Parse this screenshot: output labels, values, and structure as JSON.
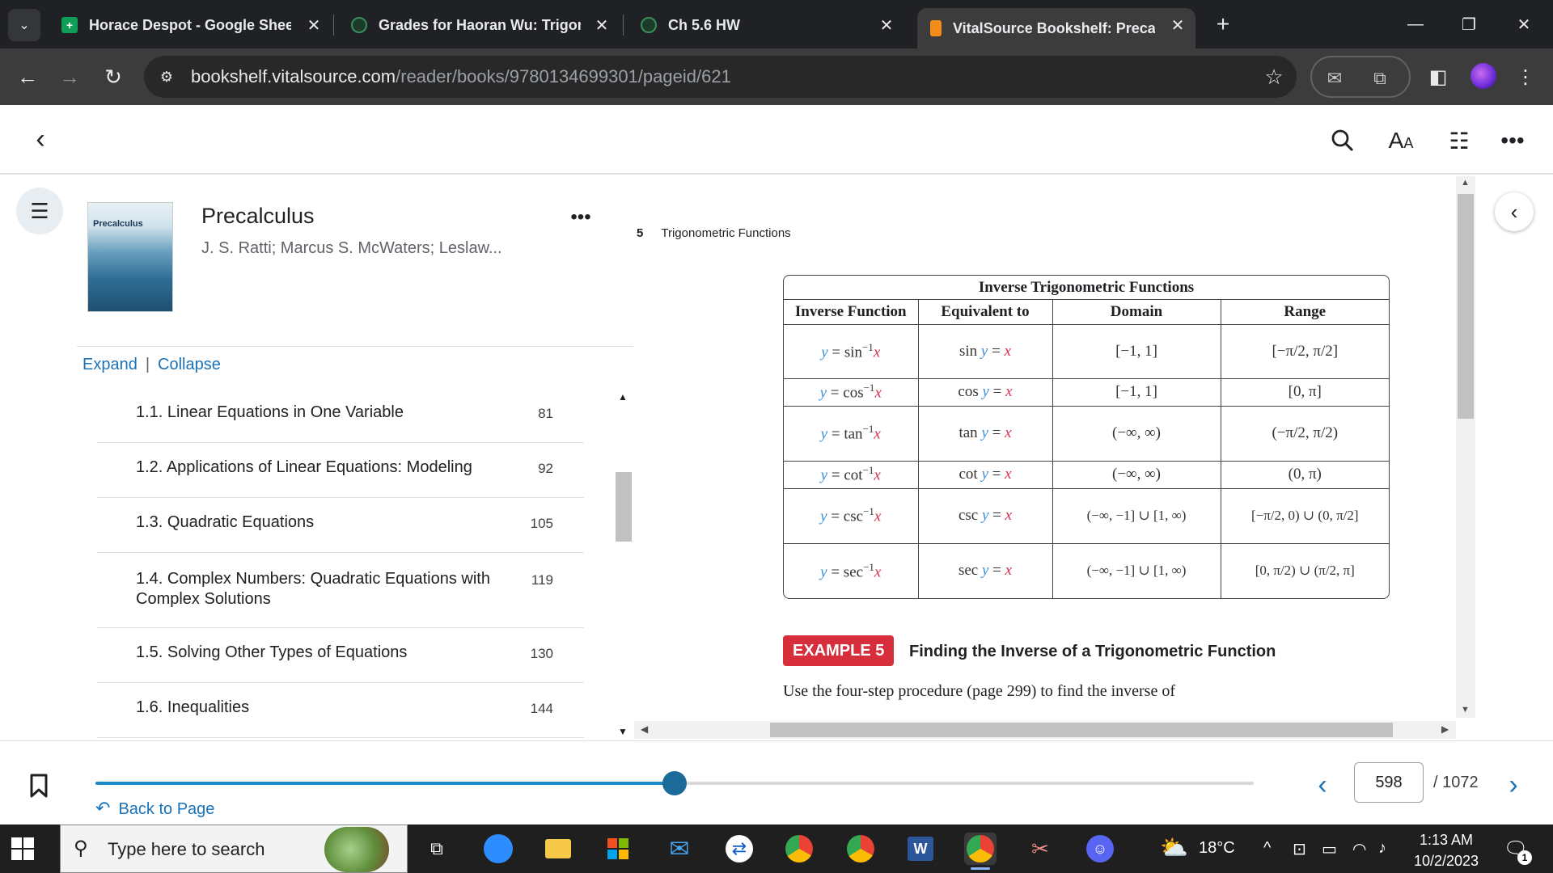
{
  "browser": {
    "tabs": [
      {
        "title": "Horace Despot - Google Sheets",
        "icon": "google-sheets-icon"
      },
      {
        "title": "Grades for Haoran Wu: Trigonometry",
        "icon": "canvas-icon"
      },
      {
        "title": "Ch 5.6 HW",
        "icon": "canvas-icon"
      },
      {
        "title": "VitalSource Bookshelf: Precalculus",
        "icon": "vitalsource-icon"
      }
    ],
    "url_host": "bookshelf.vitalsource.com",
    "url_path": "/reader/books/9780134699301/pageid/621"
  },
  "book": {
    "cover_title": "Precalculus",
    "title": "Precalculus",
    "authors": "J. S. Ratti; Marcus S. McWaters; Leslaw...",
    "expand_label": "Expand",
    "collapse_label": "Collapse",
    "toc": [
      {
        "label": "1.1. Linear Equations in One Variable",
        "page": "81"
      },
      {
        "label": "1.2. Applications of Linear Equations: Modeling",
        "page": "92"
      },
      {
        "label": "1.3. Quadratic Equations",
        "page": "105"
      },
      {
        "label": "1.4. Complex Numbers: Quadratic Equations with Complex Solutions",
        "page": "119"
      },
      {
        "label": "1.5. Solving Other Types of Equations",
        "page": "130"
      },
      {
        "label": "1.6. Inequalities",
        "page": "144"
      }
    ]
  },
  "content": {
    "chapter_number": "5",
    "chapter_title": "Trigonometric Functions",
    "table": {
      "caption": "Inverse Trigonometric Functions",
      "headers": [
        "Inverse Function",
        "Equivalent to",
        "Domain",
        "Range"
      ],
      "rows": [
        {
          "fn": "sin",
          "eq": "sin",
          "domain": "[−1, 1]",
          "range": "[−π/2, π/2]"
        },
        {
          "fn": "cos",
          "eq": "cos",
          "domain": "[−1, 1]",
          "range": "[0, π]"
        },
        {
          "fn": "tan",
          "eq": "tan",
          "domain": "(−∞, ∞)",
          "range": "(−π/2, π/2)"
        },
        {
          "fn": "cot",
          "eq": "cot",
          "domain": "(−∞, ∞)",
          "range": "(0, π)"
        },
        {
          "fn": "csc",
          "eq": "csc",
          "domain": "(−∞, −1] ∪ [1, ∞)",
          "range": "[−π/2, 0) ∪ (0, π/2]"
        },
        {
          "fn": "sec",
          "eq": "sec",
          "domain": "(−∞, −1] ∪ [1, ∞)",
          "range": "[0, π/2) ∪ (π/2, π]"
        }
      ]
    },
    "example_badge": "EXAMPLE 5",
    "example_title": "Finding the Inverse of a Trigonometric Function",
    "example_text": "Use the four-step procedure (page 299) to find the inverse of"
  },
  "navigation": {
    "back_to_page_label": "Back to Page",
    "current_page": "598",
    "total_pages": "/ 1072",
    "progress_fraction": 0.5
  },
  "taskbar": {
    "search_placeholder": "Type here to search",
    "temperature": "18°C",
    "time": "1:13 AM",
    "date": "10/2/2023",
    "notification_count": "1"
  },
  "colors": {
    "accent": "#1a73b8",
    "example_badge": "#d62f3b",
    "math_y": "#3d8fd6",
    "math_x": "#d6324f"
  }
}
